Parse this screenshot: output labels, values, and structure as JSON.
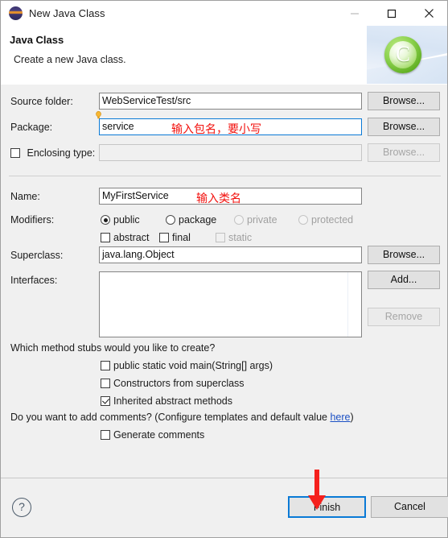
{
  "window": {
    "title": "New Java Class",
    "icon": "eclipse-globe-icon",
    "minimize": "—",
    "maximize": "□",
    "close": "✕"
  },
  "header": {
    "title": "Java Class",
    "subtitle": "Create a new Java class.",
    "badge_letter": "C"
  },
  "form": {
    "source_folder": {
      "label": "Source folder:",
      "value": "WebServiceTest/src",
      "browse": "Browse..."
    },
    "package": {
      "label": "Package:",
      "value": "service",
      "browse": "Browse...",
      "annotation": "输入包名，要小写"
    },
    "enclosing_type": {
      "label": "Enclosing type:",
      "value": "",
      "browse": "Browse...",
      "checked": false,
      "disabled": true
    },
    "name": {
      "label": "Name:",
      "value": "MyFirstService",
      "annotation": "输入类名"
    },
    "modifiers": {
      "label": "Modifiers:",
      "radios": [
        {
          "label": "public",
          "selected": true,
          "disabled": false
        },
        {
          "label": "package",
          "selected": false,
          "disabled": false
        },
        {
          "label": "private",
          "selected": false,
          "disabled": true
        },
        {
          "label": "protected",
          "selected": false,
          "disabled": true
        }
      ],
      "checkboxes": [
        {
          "label": "abstract",
          "checked": false,
          "disabled": false
        },
        {
          "label": "final",
          "checked": false,
          "disabled": false
        },
        {
          "label": "static",
          "checked": false,
          "disabled": true
        }
      ]
    },
    "superclass": {
      "label": "Superclass:",
      "value": "java.lang.Object",
      "browse": "Browse..."
    },
    "interfaces": {
      "label": "Interfaces:",
      "items": [],
      "add": "Add...",
      "remove": "Remove"
    }
  },
  "stubs": {
    "question": "Which method stubs would you like to create?",
    "options": [
      {
        "label": "public static void main(String[] args)",
        "checked": false
      },
      {
        "label": "Constructors from superclass",
        "checked": false
      },
      {
        "label": "Inherited abstract methods",
        "checked": true
      }
    ]
  },
  "comments": {
    "prefix": "Do you want to add comments? (Configure templates and default value ",
    "link": "here",
    "suffix": ")",
    "option": {
      "label": "Generate comments",
      "checked": false
    }
  },
  "footer": {
    "help": "?",
    "finish": "Finish",
    "cancel": "Cancel"
  },
  "colors": {
    "accent": "#0a7ad6",
    "annotation": "#f2110e",
    "link": "#1a4fc4",
    "badge_green": "#8cd24e"
  }
}
